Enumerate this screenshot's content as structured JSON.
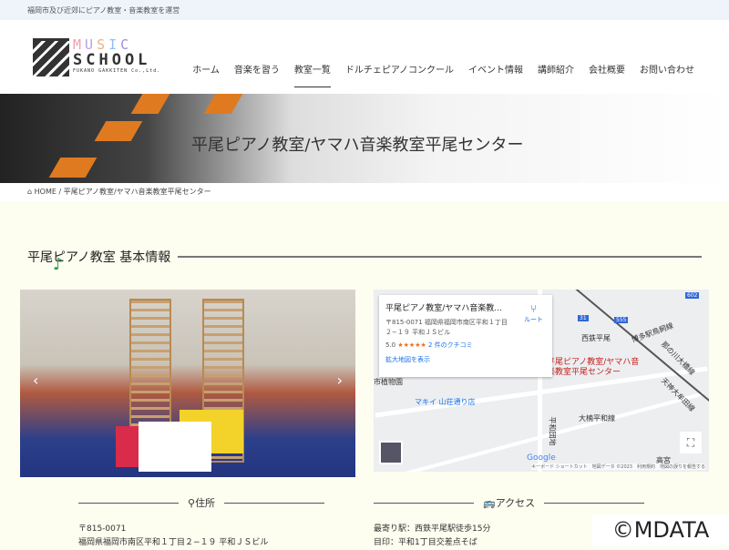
{
  "topbar": {
    "text": "福岡市及び近郊にピアノ教室・音楽教室を運営"
  },
  "logo": {
    "music": [
      "M",
      "U",
      "S",
      "I",
      "C"
    ],
    "school": "SCHOOL",
    "sub": "FUKANO GAKKITEN Co.,Ltd."
  },
  "nav": [
    "ホーム",
    "音楽を習う",
    "教室一覧",
    "ドルチェピアノコンクール",
    "イベント情報",
    "講師紹介",
    "会社概要",
    "お問い合わせ"
  ],
  "hero": {
    "title": "平尾ピアノ教室/ヤマハ音楽教室平尾センター"
  },
  "breadcrumb": {
    "home": "HOME",
    "sep": "/",
    "current": "平尾ピアノ教室/ヤマハ音楽教室平尾センター"
  },
  "section": {
    "title": "平尾ピアノ教室 基本情報"
  },
  "map": {
    "place": "平尾ピアノ教室/ヤマハ音楽教...",
    "address": "〒815-0071 福岡県福岡市南区平和１丁目２−１９ 平和ＪＳビル",
    "route": "ルート",
    "rating": "5.0",
    "stars": "★★★★★",
    "reviews": "2 件のクチコミ",
    "larger": "拡大地図を表示",
    "pin": "平尾ピアノ教室/ヤマハ音楽教室平尾センター",
    "labels": [
      "西鉄平尾",
      "博多駅鳥飼線",
      "那の川大橋線",
      "天神大牟田線",
      "市植物園",
      "マキイ 山荘通り店",
      "大楠平和線",
      "平和団地",
      "高宮",
      "602",
      "555",
      "31"
    ],
    "google": "Google",
    "attrib": "キーボード ショートカット　地図データ ©2023　利用規約　地図の誤りを報告する"
  },
  "address": {
    "heading": "住所",
    "zip": "〒815-0071",
    "line": "福岡県福岡市南区平和１丁目２−１９ 平和ＪＳビル"
  },
  "access": {
    "heading": "アクセス",
    "station": "最寄り駅：西鉄平尾駅徒歩15分",
    "landmark": "目印：平和1丁目交差点そば"
  },
  "watermark": "©MDATA"
}
